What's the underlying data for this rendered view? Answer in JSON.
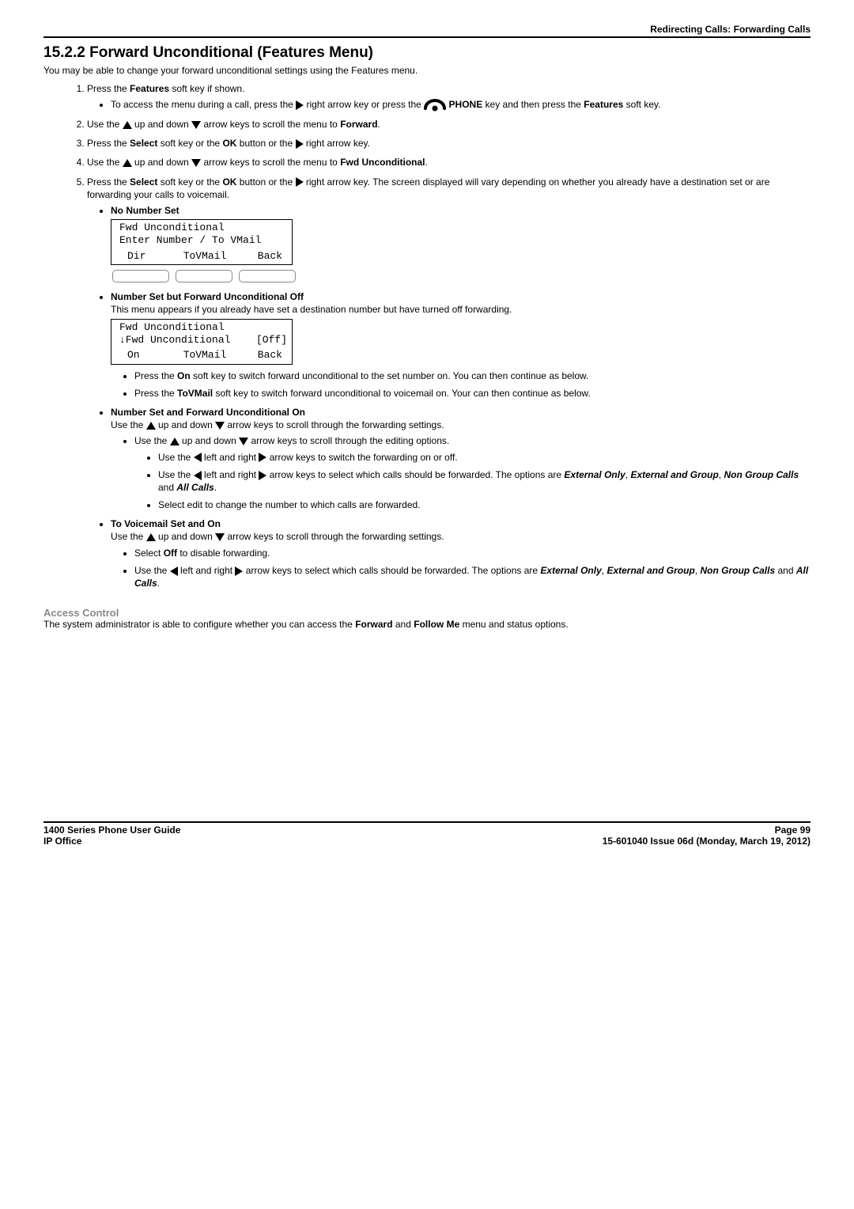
{
  "header": {
    "right": "Redirecting Calls: Forwarding Calls"
  },
  "title": "15.2.2 Forward Unconditional (Features Menu)",
  "intro": "You may be able to change your forward unconditional settings using the Features menu.",
  "steps": {
    "s1_a": "Press the ",
    "s1_b": "Features",
    "s1_c": " soft key if shown.",
    "s1_bul_a": "To access the menu during a call, press the ",
    "s1_bul_b": " right arrow key or press the ",
    "s1_bul_phone": " PHONE",
    "s1_bul_c": " key and then press the ",
    "s1_bul_d": "Features",
    "s1_bul_e": " soft key.",
    "s2_a": "Use the ",
    "s2_b": " up and down ",
    "s2_c": " arrow keys to scroll the menu to ",
    "s2_d": "Forward",
    "s2_e": ".",
    "s3_a": "Press the ",
    "s3_b": "Select",
    "s3_c": " soft key or the ",
    "s3_d": "OK",
    "s3_e": " button or the ",
    "s3_f": " right arrow key.",
    "s4_a": "Use the ",
    "s4_b": " up and down ",
    "s4_c": " arrow keys to scroll the menu to ",
    "s4_d": "Fwd Unconditional",
    "s4_e": ".",
    "s5_a": "Press the ",
    "s5_b": "Select",
    "s5_c": " soft key or the ",
    "s5_d": "OK",
    "s5_e": " button or the ",
    "s5_f": " right arrow key. The screen displayed will vary depending on whether you already have a destination set or are forwarding your calls to voicemail."
  },
  "noNumber": {
    "heading": "No Number Set",
    "lcd1": "Fwd Unconditional",
    "lcd2": "Enter Number / To VMail",
    "c1": "Dir",
    "c2": "ToVMail",
    "c3": "Back"
  },
  "numOff": {
    "heading": "Number Set but Forward Unconditional Off",
    "desc": "This menu appears if you already have set a destination number but have turned off forwarding.",
    "lcd1": "Fwd Unconditional",
    "lcd2": "↓Fwd Unconditional",
    "lcd2_right": "[Off]",
    "c1": "On",
    "c2": "ToVMail",
    "c3": "Back",
    "b1_a": "Press the ",
    "b1_b": "On",
    "b1_c": " soft key to switch forward unconditional to the set number on. You can then continue as below.",
    "b2_a": "Press the ",
    "b2_b": "ToVMail",
    "b2_c": " soft key to switch forward unconditional to voicemail on. Your can then continue as below."
  },
  "numOn": {
    "heading": "Number Set and Forward Unconditional On",
    "l1_a": "Use the ",
    "l1_b": " up and down ",
    "l1_c": " arrow keys to scroll through the forwarding settings.",
    "l2_a": "Use the ",
    "l2_b": " up and down ",
    "l2_c": " arrow keys to scroll through the editing options.",
    "l3_a": "Use the ",
    "l3_b": " left and right ",
    "l3_c": " arrow keys to switch the forwarding on or off.",
    "l4_a": "Use the ",
    "l4_b": " left and right ",
    "l4_c": " arrow keys to select which calls should be forwarded. The options are ",
    "opts1": "External Only",
    "sep": ", ",
    "opts2": "External and Group",
    "opts3": "Non Group Calls",
    "and": " and ",
    "opts4": "All Calls",
    "period": ".",
    "l5": "Select edit to change the number to which calls are forwarded."
  },
  "vmOn": {
    "heading": "To Voicemail Set and On",
    "l1_a": "Use the ",
    "l1_b": " up and down ",
    "l1_c": " arrow keys to scroll through the forwarding settings.",
    "b1_a": "Select ",
    "b1_b": "Off",
    "b1_c": " to disable forwarding.",
    "b2_a": "Use the ",
    "b2_b": " left and right ",
    "b2_c": " arrow keys to select which calls should be forwarded. The options are ",
    "opts1": "External Only",
    "sep": ", ",
    "opts2": "External and Group",
    "opts3": "Non Group Calls",
    "and": " and ",
    "opts4": "All Calls",
    "period": "."
  },
  "access": {
    "heading": "Access Control",
    "p_a": "The system administrator is able to configure whether you can access the ",
    "p_b": "Forward",
    "p_c": " and ",
    "p_d": "Follow Me",
    "p_e": " menu and status options."
  },
  "footer": {
    "leftTop": "1400 Series Phone User Guide",
    "rightTop": "Page 99",
    "leftBottom": "IP Office",
    "rightBottom": "15-601040 Issue 06d (Monday, March 19, 2012)"
  }
}
